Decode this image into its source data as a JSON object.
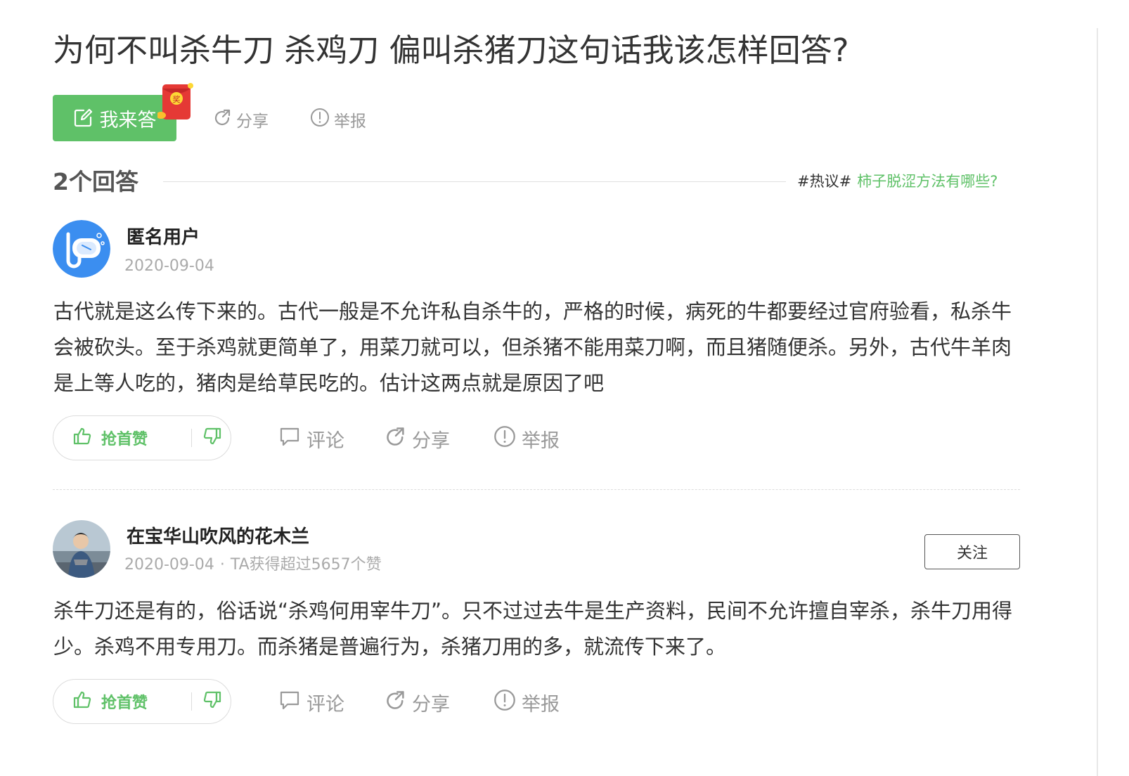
{
  "question": {
    "title": "为何不叫杀牛刀 杀鸡刀 偏叫杀猪刀这句话我该怎样回答?",
    "answer_button_label": "我来答",
    "red_packet_label": "奖",
    "share_label": "分享",
    "report_label": "举报"
  },
  "answers_header": {
    "count_label": "2个回答",
    "hot_tag": "#热议#",
    "hot_link": "柿子脱涩方法有哪些?"
  },
  "answers": [
    {
      "username": "匿名用户",
      "date": "2020-09-04",
      "text": "古代就是这么传下来的。古代一般是不允许私自杀牛的，严格的时候，病死的牛都要经过官府验看，私杀牛会被砍头。至于杀鸡就更简单了，用菜刀就可以，但杀猪不能用菜刀啊，而且猪随便杀。另外，古代牛羊肉是上等人吃的，猪肉是给草民吃的。估计这两点就是原因了吧",
      "vote_label": "抢首赞",
      "comment_label": "评论",
      "share_label": "分享",
      "report_label": "举报"
    },
    {
      "username": "在宝华山吹风的花木兰",
      "date": "2020-09-04",
      "dot": "·",
      "likes_info": "TA获得超过5657个赞",
      "follow_label": "关注",
      "text": "杀牛刀还是有的，俗话说“杀鸡何用宰牛刀”。只不过过去牛是生产资料，民间不允许擅自宰杀，杀牛刀用得少。杀鸡不用专用刀。而杀猪是普遍行为，杀猪刀用的多，就流传下来了。",
      "vote_label": "抢首赞",
      "comment_label": "评论",
      "share_label": "分享",
      "report_label": "举报"
    }
  ],
  "colors": {
    "accent_green": "#5fc168",
    "text_dark": "#333333",
    "text_muted": "#999999",
    "avatar_blue": "#3b8ef0",
    "red_packet": "#e53935"
  },
  "icons": [
    "edit-icon",
    "red-packet-icon",
    "share-icon",
    "report-icon",
    "thumbs-up-icon",
    "thumbs-down-icon",
    "comment-icon"
  ]
}
